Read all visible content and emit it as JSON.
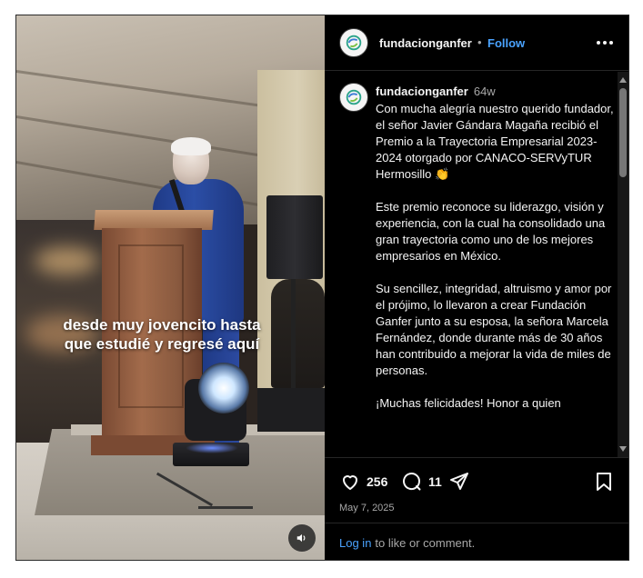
{
  "post": {
    "username": "fundacionganfer",
    "follow_label": "Follow",
    "separator": "•",
    "time_ago": "64w",
    "caption": "Con mucha alegría nuestro querido fundador, el señor Javier Gándara Magaña recibió el Premio a la Trayectoria Empresarial 2023-2024 otorgado por CANACO-SERVyTUR Hermosillo 👏\n\nEste premio reconoce su liderazgo, visión y experiencia, con la cual ha consolidado una gran trayectoria como uno de los mejores empresarios en México.\n\nSu sencillez, integridad, altruismo y amor por el prójimo, lo llevaron a crear Fundación Ganfer junto a su esposa, la señora Marcela Fernández, donde durante más de 30 años han contribuido a mejorar la vida de miles de personas.\n\n¡Muchas felicidades! Honor a quien",
    "likes": "256",
    "comments": "11",
    "date": "May 7, 2025"
  },
  "video": {
    "caption_text": "desde muy jovencito hasta que estudié y regresé aquí",
    "mute_icon": "speaker-icon"
  },
  "footer": {
    "login_link": "Log in",
    "login_rest": "to like or comment."
  },
  "colors": {
    "accent": "#4aa3ff",
    "background": "#000000",
    "text": "#f5f5f5",
    "muted": "#a8a8a8"
  }
}
